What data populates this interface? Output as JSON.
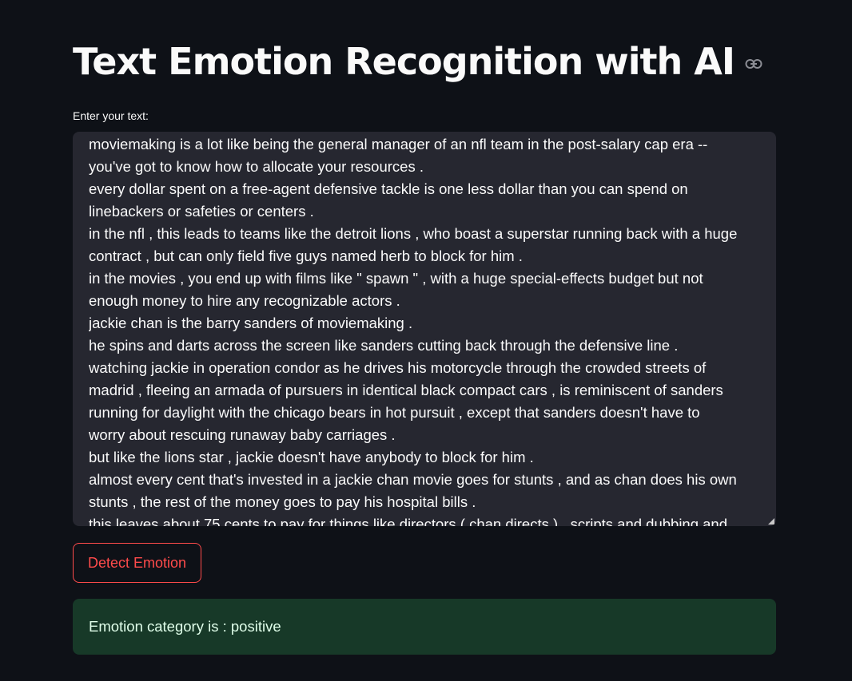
{
  "header": {
    "title": "Text Emotion Recognition with AI",
    "anchor_icon": "link-icon"
  },
  "input": {
    "label": "Enter your text:",
    "lines": [
      "moviemaking is a lot like being the general manager of an nfl team in the post-salary cap era --",
      "you've got to know how to allocate your resources .",
      "every dollar spent on a free-agent defensive tackle is one less dollar than you can spend on",
      "linebackers or safeties or centers .",
      "in the nfl , this leads to teams like the detroit lions , who boast a superstar running back with a huge",
      "contract , but can only field five guys named herb to block for him .",
      "in the movies , you end up with films like \" spawn \" , with a huge special-effects budget but not",
      "enough money to hire any recognizable actors .",
      "jackie chan is the barry sanders of moviemaking .",
      "he spins and darts across the screen like sanders cutting back through the defensive line .",
      "watching jackie in operation condor as he drives his motorcycle through the crowded streets of",
      "madrid , fleeing an armada of pursuers in identical black compact cars , is reminiscent of sanders",
      "running for daylight with the chicago bears in hot pursuit , except that sanders doesn't have to",
      "worry about rescuing runaway baby carriages .",
      "but like the lions star , jackie doesn't have anybody to block for him .",
      "almost every cent that's invested in a jackie chan movie goes for stunts , and as chan does his own",
      "stunts , the rest of the money goes to pay his hospital bills .",
      "this leaves about 75 cents to pay for things like directors ( chan directs ) , scripts and dubbing and"
    ]
  },
  "button": {
    "label": "Detect Emotion"
  },
  "result": {
    "text": "Emotion category is : positive"
  },
  "colors": {
    "background": "#0e1117",
    "textarea_bg": "#262730",
    "accent": "#ff4b4b",
    "success_bg": "#173928",
    "success_text": "#dffde9"
  }
}
